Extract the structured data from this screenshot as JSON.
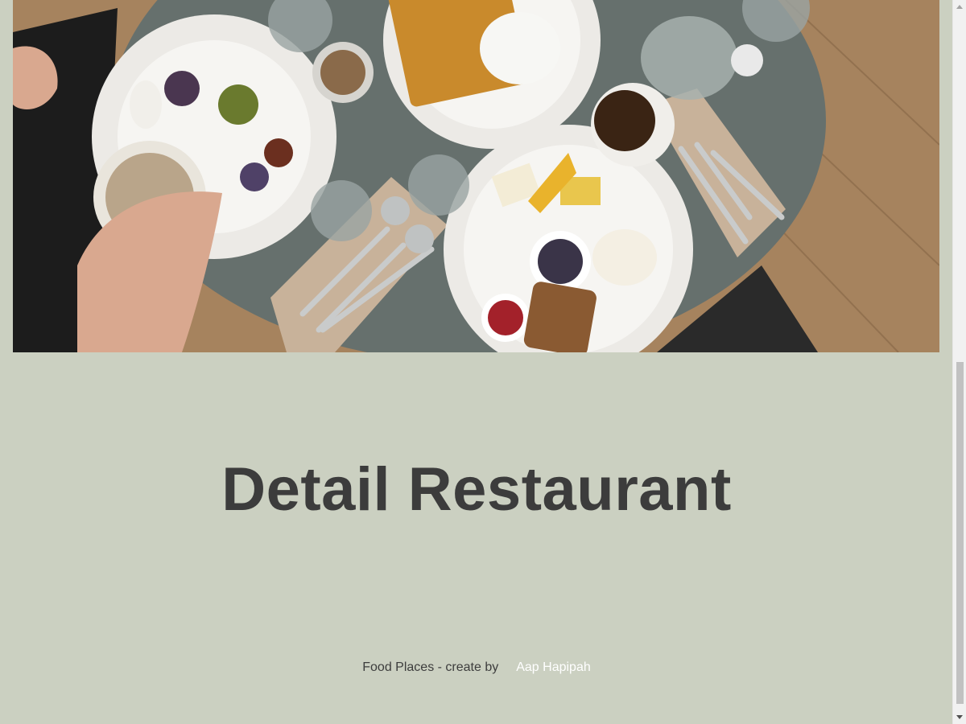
{
  "hero": {
    "image_subject": "breakfast table food photo"
  },
  "main": {
    "title": "Detail Restaurant"
  },
  "footer": {
    "text": "Food Places - create by",
    "author_link": "Aap Hapipah"
  },
  "colors": {
    "page_background": "#cbd0c1",
    "title_text": "#3c3c3c",
    "footer_text": "#3d3d3d",
    "author_link": "#ffffff"
  }
}
